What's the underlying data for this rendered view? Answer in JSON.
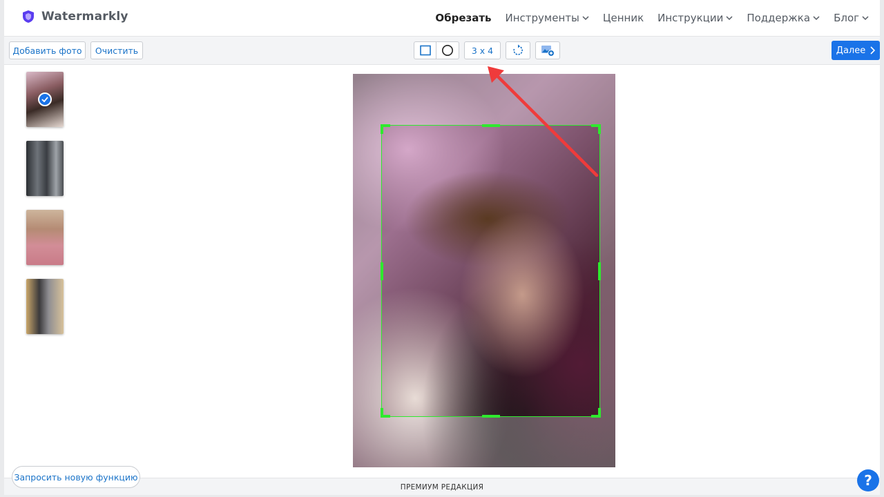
{
  "brand": {
    "name": "Watermarkly",
    "color": "#5a3df0"
  },
  "nav": {
    "items": [
      {
        "label": "Обрезать",
        "active": true,
        "dropdown": false
      },
      {
        "label": "Инструменты",
        "active": false,
        "dropdown": true
      },
      {
        "label": "Ценник",
        "active": false,
        "dropdown": false
      },
      {
        "label": "Инструкции",
        "active": false,
        "dropdown": true
      },
      {
        "label": "Поддержка",
        "active": false,
        "dropdown": true
      },
      {
        "label": "Блог",
        "active": false,
        "dropdown": true
      }
    ]
  },
  "toolbar": {
    "add_photo": "Добавить фото",
    "clear": "Очистить",
    "ratio": "3 x 4",
    "next": "Далее",
    "tools": [
      "rectangle-crop-icon",
      "circle-crop-icon",
      "rotate-icon",
      "add-image-icon"
    ]
  },
  "thumbnails": [
    {
      "selected": true
    },
    {
      "selected": false
    },
    {
      "selected": false
    },
    {
      "selected": false
    }
  ],
  "footer": {
    "request_feature": "Запросить новую функцию",
    "edition": "ПРЕМИУМ РЕДАКЦИЯ",
    "help": "?"
  },
  "colors": {
    "accent": "#1a73e8",
    "crop": "#2eea2e",
    "arrow": "#ef3b3b"
  }
}
